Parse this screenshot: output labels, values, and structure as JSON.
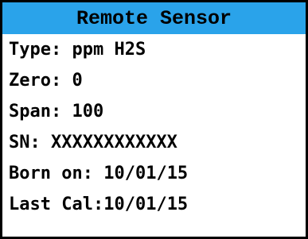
{
  "title": "Remote Sensor",
  "colors": {
    "title_bar": "#2aa3ea",
    "text": "#000000",
    "border": "#000000",
    "background": "#ffffff"
  },
  "rows": [
    {
      "label": "Type:",
      "value": "ppm H2S"
    },
    {
      "label": "Zero:",
      "value": "0"
    },
    {
      "label": "Span:",
      "value": "100"
    },
    {
      "label": "SN:",
      "value": "XXXXXXXXXXXX"
    },
    {
      "label": "Born on:",
      "value": "10/01/15"
    },
    {
      "label": "Last Cal:",
      "value": "10/01/15"
    }
  ]
}
